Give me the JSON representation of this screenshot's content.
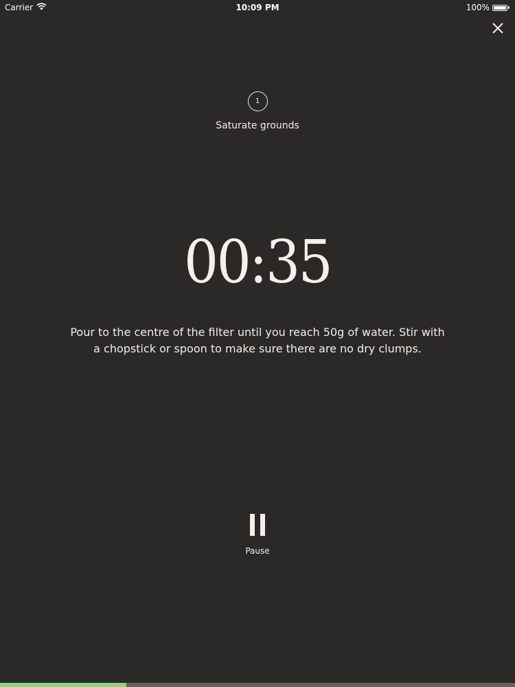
{
  "status_bar": {
    "carrier": "Carrier",
    "time": "10:09 PM",
    "battery_text": "100%",
    "battery_level": 1.0,
    "wifi_icon": "wifi-icon",
    "battery_icon": "battery-icon"
  },
  "close_icon": "close-icon",
  "step": {
    "number": "1",
    "title": "Saturate grounds"
  },
  "timer": {
    "time": "00:35"
  },
  "instructions": "Pour to the centre of the filter until you reach 50g of water. Stir with a chopstick or spoon to make sure there are no dry clumps.",
  "pause": {
    "icon": "pause-icon",
    "label": "Pause"
  },
  "progress": {
    "fraction": 0.245
  },
  "colors": {
    "background": "#2b2828",
    "text": "#f2eeea",
    "progress_fill": "#8fd47f",
    "progress_track": "#66625e"
  }
}
